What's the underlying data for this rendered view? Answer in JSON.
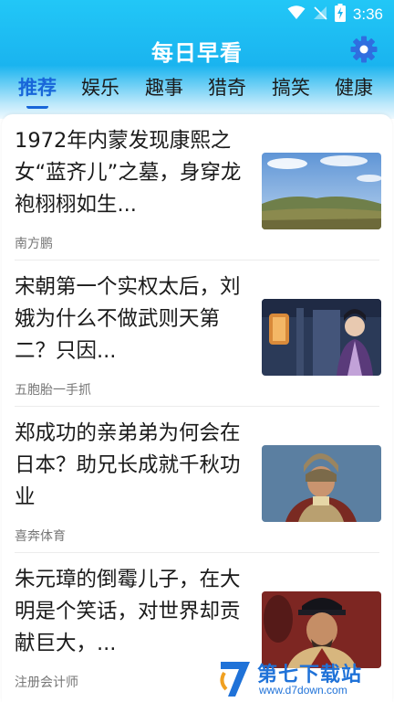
{
  "status_bar": {
    "time": "3:36",
    "icons": [
      "wifi-icon",
      "signal-off-icon",
      "battery-charging-icon"
    ]
  },
  "header": {
    "app_title": "每日早看",
    "settings_icon": "gear-icon",
    "accent_color": "#1866d9",
    "header_color": "#1ab4ef"
  },
  "tabs": [
    {
      "label": "推荐",
      "active": true
    },
    {
      "label": "娱乐",
      "active": false
    },
    {
      "label": "趣事",
      "active": false
    },
    {
      "label": "猎奇",
      "active": false
    },
    {
      "label": "搞笑",
      "active": false
    },
    {
      "label": "健康",
      "active": false
    }
  ],
  "articles": [
    {
      "title": "1972年内蒙发现康熙之女“蓝齐儿”之墓，身穿龙袍栩栩如生...",
      "source": "南方鹏",
      "thumb": "grassland-landscape"
    },
    {
      "title": "宋朝第一个实权太后，刘娥为什么不做武则天第二？只因...",
      "source": "五胞胎一手抓",
      "thumb": "empress-drama-still"
    },
    {
      "title": "郑成功的亲弟弟为何会在日本？助兄长成就千秋功业",
      "source": "喜奔体育",
      "thumb": "armored-general-still"
    },
    {
      "title": "朱元璋的倒霉儿子，在大明是个笑话，对世界却贡献巨大，...",
      "source": "注册会计师",
      "thumb": "ming-official-still"
    }
  ],
  "watermark": {
    "text": "第七下载站",
    "url": "www.d7down.com"
  }
}
